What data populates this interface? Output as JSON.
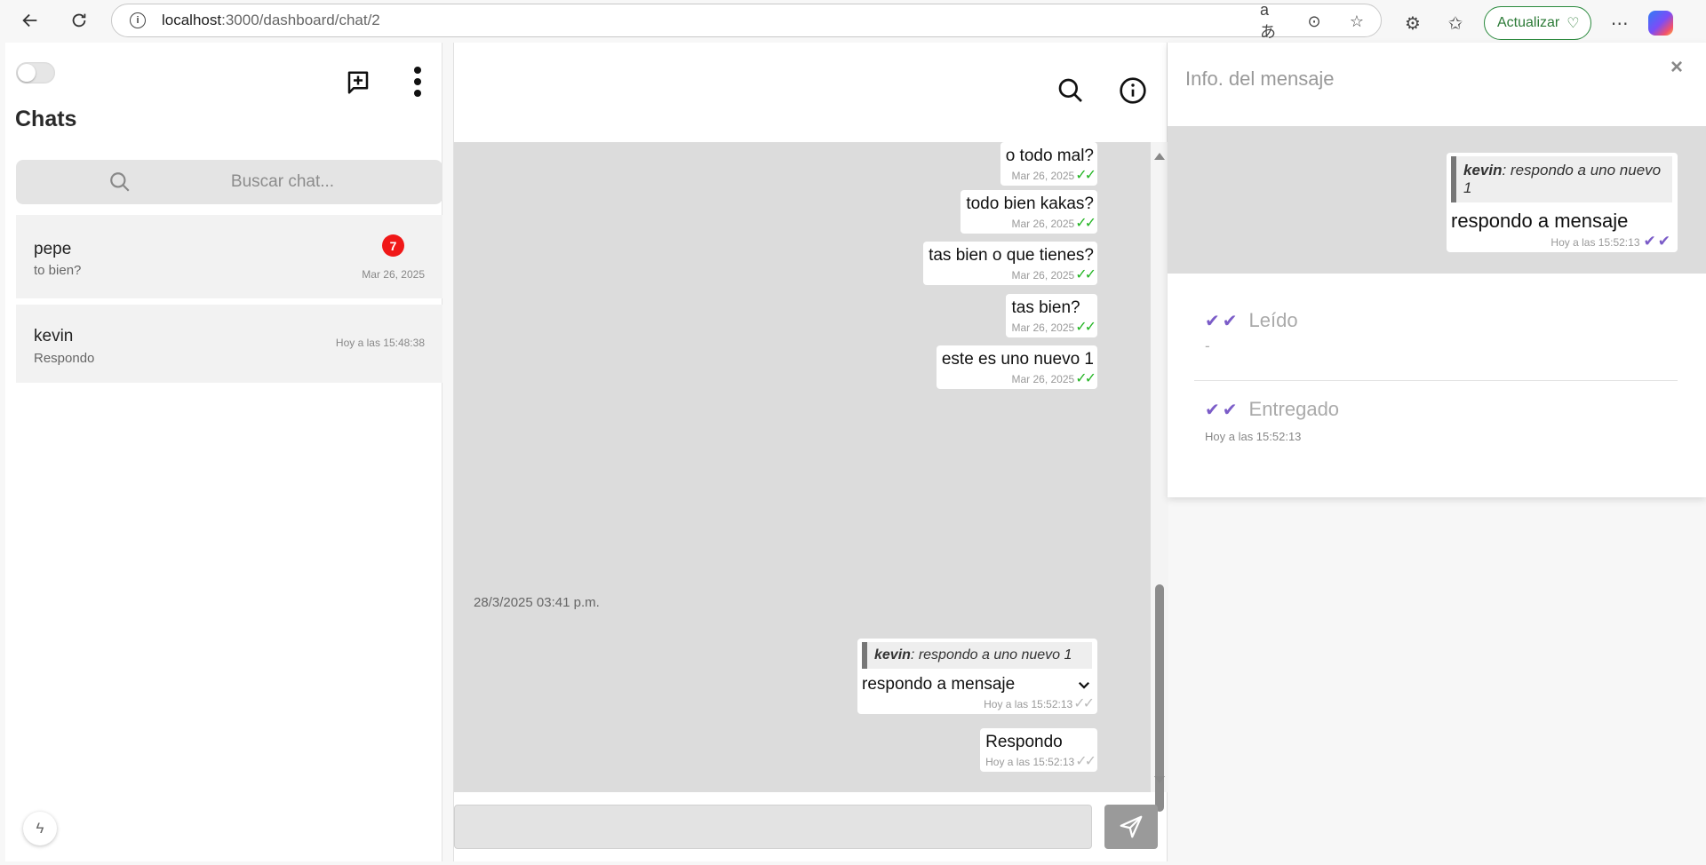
{
  "browser": {
    "url_host": "localhost",
    "url_path": ":3000/dashboard/chat/2",
    "update_label": "Actualizar"
  },
  "sidebar": {
    "title": "Chats",
    "search_placeholder": "Buscar chat...",
    "chats": [
      {
        "name": "pepe",
        "preview": "to bien?",
        "time": "Mar 26, 2025",
        "unread": "7"
      },
      {
        "name": "kevin",
        "preview": "Respondo",
        "time": "Hoy a las 15:48:38"
      }
    ]
  },
  "chat": {
    "messages": [
      {
        "text": "o todo mal?",
        "time": "Mar 26, 2025"
      },
      {
        "text": "todo bien kakas?",
        "time": "Mar 26, 2025"
      },
      {
        "text": "tas bien o que tienes?",
        "time": "Mar 26, 2025"
      },
      {
        "text": "tas bien?",
        "time": "Mar 26, 2025"
      },
      {
        "text": "este es uno nuevo 1",
        "time": "Mar 26, 2025"
      }
    ],
    "date_separator": "28/3/2025 03:41 p.m.",
    "reply_message": {
      "quote_author": "kevin",
      "quote_text": ": respondo a uno nuevo 1",
      "text": "respondo a mensaje",
      "time": "Hoy a las 15:52:13"
    },
    "last_message": {
      "text": "Respondo",
      "time": "Hoy a las 15:52:13"
    },
    "composer_value": ""
  },
  "info": {
    "title": "Info. del mensaje",
    "close": "×",
    "preview": {
      "quote_author": "kevin",
      "quote_text": ": respondo a uno nuevo 1",
      "text": "respondo a mensaje",
      "time": "Hoy a las 15:52:13"
    },
    "read_label": "Leído",
    "read_value": "-",
    "delivered_label": "Entregado",
    "delivered_value": "Hoy a las 15:52:13"
  },
  "colors": {
    "accent_check_read": "#7b5cc8",
    "check_green": "#22b422",
    "badge": "#f01818"
  }
}
